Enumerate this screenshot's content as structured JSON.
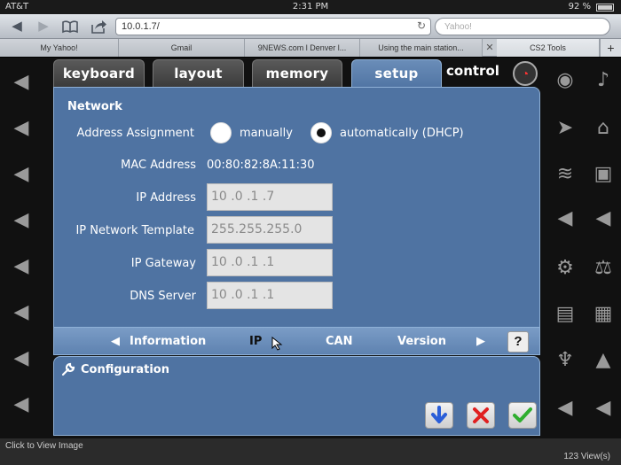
{
  "status": {
    "carrier": "AT&T",
    "time": "2:31 PM",
    "battery": "92 %"
  },
  "browser": {
    "url": "10.0.1.7/",
    "search_placeholder": "Yahoo!",
    "tabs": [
      {
        "label": "My Yahoo!"
      },
      {
        "label": "Gmail"
      },
      {
        "label": "9NEWS.com l Denver l..."
      },
      {
        "label": "Using the main station..."
      },
      {
        "label": "CS2 Tools"
      }
    ],
    "new_tab": "+"
  },
  "app": {
    "tabs": [
      {
        "label": "keyboard"
      },
      {
        "label": "layout"
      },
      {
        "label": "memory"
      },
      {
        "label": "setup"
      },
      {
        "label": "control"
      }
    ],
    "network": {
      "title": "Network",
      "address_assignment_label": "Address Assignment",
      "option_manual": "manually",
      "option_auto": "automatically (DHCP)",
      "mac_label": "MAC Address",
      "mac_value": "00:80:82:8A:11:30",
      "ip_label": "IP Address",
      "ip_value": "10 .0 .1 .7",
      "template_label": "IP Network Template",
      "template_value": "255.255.255.0",
      "gateway_label": "IP Gateway",
      "gateway_value": "10 .0 .1 .1",
      "dns_label": "DNS Server",
      "dns_value": "10 .0 .1 .1"
    },
    "subnav": {
      "items": [
        "Information",
        "IP",
        "CAN",
        "Version"
      ],
      "help": "?"
    },
    "configuration": {
      "title": "Configuration"
    }
  },
  "footer": {
    "left": "Click to View Image",
    "right": "123 View(s)"
  }
}
